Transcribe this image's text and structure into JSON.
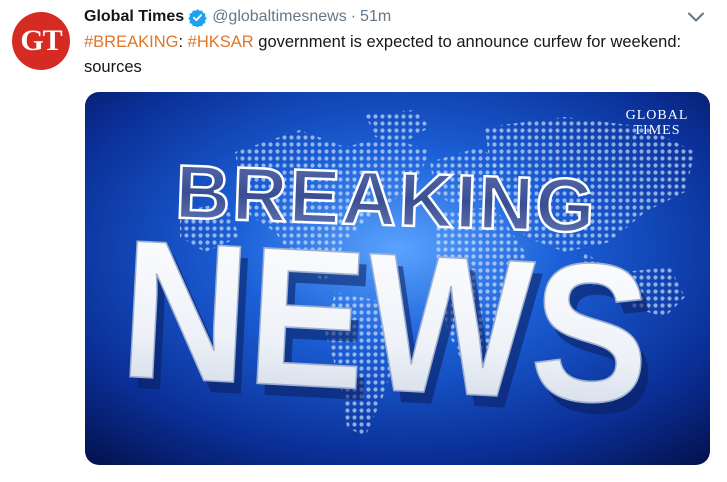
{
  "tweet": {
    "avatar_text": "GT",
    "name": "Global Times",
    "handle": "@globaltimesnews",
    "separator": "·",
    "time": "51m",
    "hashtag_breaking": "#BREAKING",
    "colon_after_first": ":",
    "hashtag_hksar": "#HKSAR",
    "body": "government is expected to announce curfew for weekend: sources"
  },
  "media": {
    "watermark_line1": "GLOBAL",
    "watermark_line2": "TIMES",
    "headline_line1": "BREAKING",
    "headline_line2": "NEWS"
  },
  "colors": {
    "brand_red": "#d62b22",
    "hashtag_orange": "#e0762a",
    "verified_blue": "#1da1f2",
    "muted_gray": "#657786",
    "image_blue": "#0a3aa8"
  }
}
